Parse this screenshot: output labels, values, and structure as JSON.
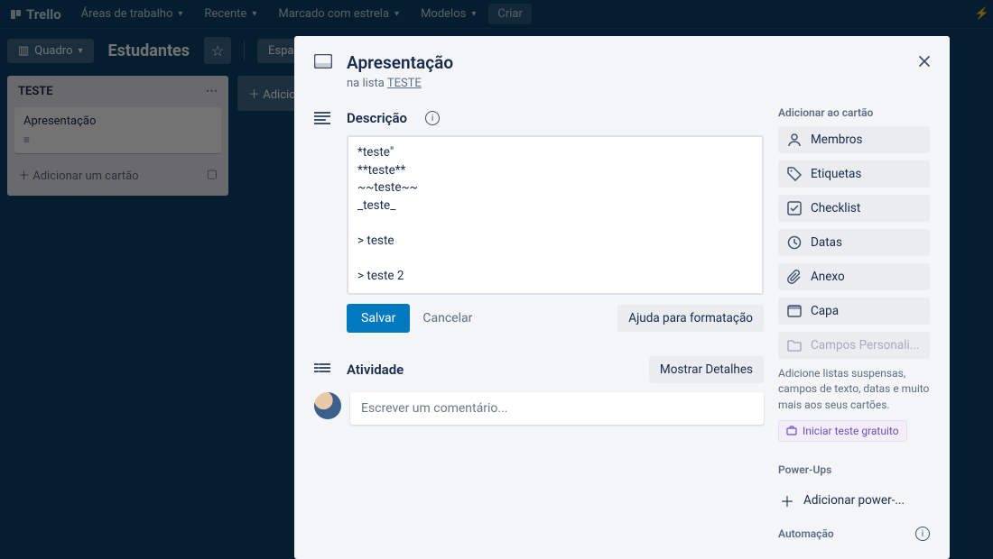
{
  "brand": "Trello",
  "nav": {
    "workspaces": "Áreas de trabalho",
    "recent": "Recente",
    "starred": "Marcado com estrela",
    "templates": "Modelos",
    "create": "Criar"
  },
  "boardbar": {
    "view": "Quadro",
    "title": "Estudantes",
    "workspace_btn": "Espaço d"
  },
  "list": {
    "name": "TESTE",
    "card_title": "Apresentação",
    "add_card": "Adicionar um cartão"
  },
  "add_list": "Adicio",
  "card": {
    "title": "Apresentação",
    "in_list_prefix": "na lista ",
    "list_name": "TESTE",
    "description_label": "Descrição",
    "description_value": "*teste\"\n**teste**\n~~teste~~\n_teste_\n\n> teste\n\n> teste 2",
    "save": "Salvar",
    "cancel": "Cancelar",
    "format_help": "Ajuda para formatação",
    "activity_label": "Atividade",
    "show_details": "Mostrar Detalhes",
    "comment_placeholder": "Escrever um comentário..."
  },
  "sidebar": {
    "add_section": "Adicionar ao cartão",
    "members": "Membros",
    "labels": "Etiquetas",
    "checklist": "Checklist",
    "dates": "Datas",
    "attachment": "Anexo",
    "cover": "Capa",
    "custom_fields": "Campos Personali...",
    "cf_note": "Adicione listas suspensas, campos de texto, datas e muito mais aos seus cartões.",
    "start_trial": "Iniciar teste gratuito",
    "powerups_section": "Power-Ups",
    "add_powerup": "Adicionar power-...",
    "automation_section": "Automação"
  }
}
